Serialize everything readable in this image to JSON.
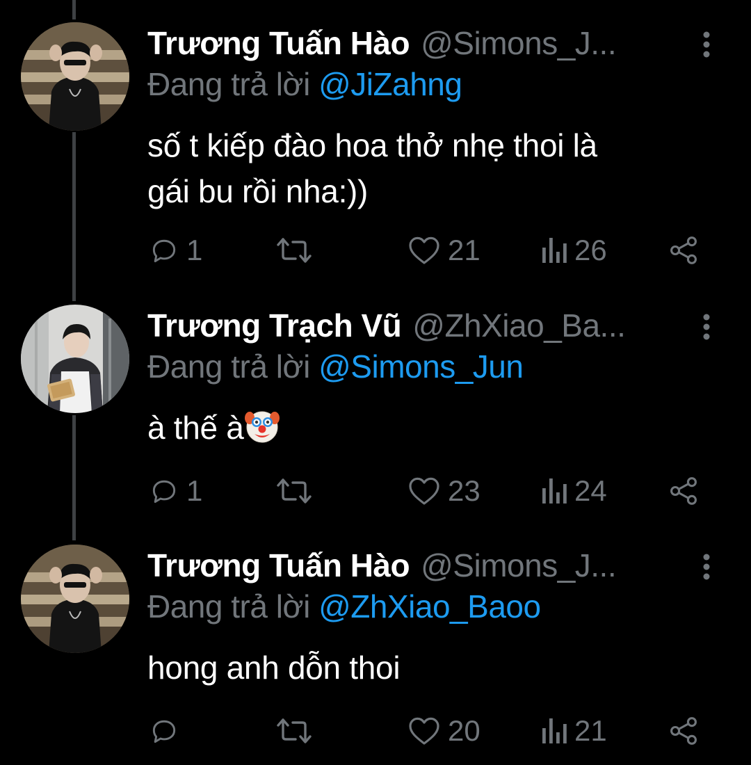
{
  "colors": {
    "background": "#000000",
    "name": "#ffffff",
    "secondary": "#71767b",
    "mention": "#1d9bf0",
    "thread_line": "#3e4144"
  },
  "reply_prefix": "Đang trả lời",
  "tweets": [
    {
      "author_name": "Trương Tuấn Hào",
      "handle": "@Simons_J...",
      "reply_to": "@JiZahng",
      "text_line1": "số t kiếp đào hoa thở nhẹ thoi là",
      "text_line2": "gái bu rồi nha:))",
      "replies": "1",
      "retweets": "",
      "likes": "21",
      "views": "26"
    },
    {
      "author_name": "Trương Trạch Vũ",
      "handle": "@ZhXiao_Ba...",
      "reply_to": "@Simons_Jun",
      "text_line1": "à thế à",
      "emoji": "clown-face",
      "replies": "1",
      "retweets": "",
      "likes": "23",
      "views": "24"
    },
    {
      "author_name": "Trương Tuấn Hào",
      "handle": "@Simons_J...",
      "reply_to": "@ZhXiao_Baoo",
      "text_line1": "hong anh dỗn thoi",
      "replies": "",
      "retweets": "",
      "likes": "20",
      "views": "21"
    }
  ],
  "icons": {
    "reply": "reply-icon",
    "retweet": "retweet-icon",
    "like": "heart-icon",
    "views": "views-icon",
    "share": "share-icon",
    "more": "more-vertical-icon"
  }
}
